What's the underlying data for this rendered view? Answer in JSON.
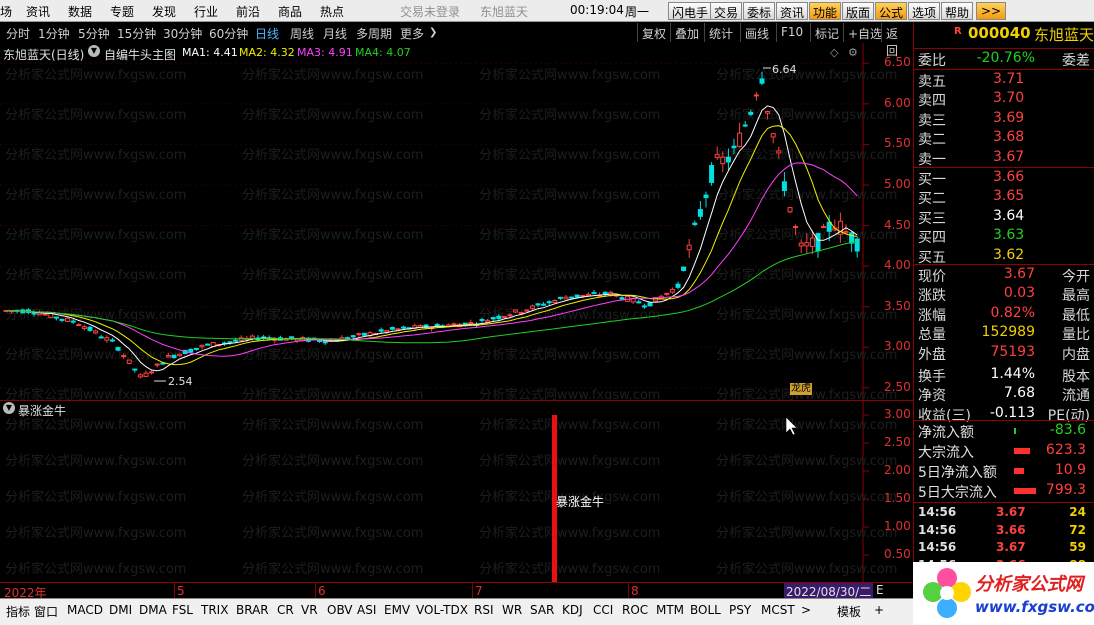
{
  "menubar": {
    "items": [
      "场",
      "资讯",
      "数据",
      "专题",
      "发现",
      "行业",
      "前沿",
      "商品",
      "热点"
    ],
    "status_login": "交易未登录",
    "status_stock": "东旭蓝天",
    "clock": "00:19:04",
    "weekday": "周一",
    "buttons": [
      "闪电手",
      "交易",
      "委标",
      "资讯",
      "功能",
      "版面",
      "公式",
      "选项",
      "帮助",
      ">>"
    ]
  },
  "periodbar": {
    "periods": [
      "分时",
      "1分钟",
      "5分钟",
      "15分钟",
      "30分钟",
      "60分钟",
      "日线",
      "周线",
      "月线",
      "多周期",
      "更多"
    ],
    "selected": "日线",
    "tools": [
      "复权",
      "叠加",
      "统计",
      "画线",
      "F10",
      "标记",
      "+自选",
      "返回"
    ]
  },
  "main_chart": {
    "title": "东旭蓝天(日线)",
    "formula": "自编牛头主图",
    "ma1": "MA1: 4.41",
    "ma2": "MA2: 4.32",
    "ma3": "MA3: 4.91",
    "ma4": "MA4: 4.07",
    "high_label": "6.64",
    "low_label": "2.54",
    "tag": "龙虎",
    "y_ticks": [
      "6.50",
      "6.00",
      "5.50",
      "5.00",
      "4.50",
      "4.00",
      "3.50",
      "3.00",
      "2.50"
    ]
  },
  "sub_chart": {
    "title": "暴涨金牛",
    "signal_label": "暴涨金牛",
    "y_ticks": [
      "3.00",
      "2.50",
      "2.00",
      "1.50",
      "1.00",
      "0.50"
    ]
  },
  "time_axis": {
    "labels": [
      "2022年",
      "5",
      "6",
      "7",
      "8"
    ],
    "current_date": "2022/08/30/二",
    "right_label": "E"
  },
  "watermark": "分析家公式网www.fxgsw.com",
  "bottombar": {
    "items": [
      "指标",
      "窗口",
      "MACD",
      "DMI",
      "DMA",
      "FSL",
      "TRIX",
      "BRAR",
      "CR",
      "VR",
      "OBV",
      "ASI",
      "EMV",
      "VOL-TDX",
      "RSI",
      "WR",
      "SAR",
      "KDJ",
      "CCI",
      "ROC",
      "MTM",
      "BOLL",
      "PSY",
      "MCST",
      ">",
      "模板",
      "+"
    ]
  },
  "quote": {
    "mark": "R",
    "code": "000040",
    "name": "东旭蓝天",
    "weibi_label": "委比",
    "weibi_value": "-20.76%",
    "weicha_label": "委差",
    "asks": [
      {
        "label": "卖五",
        "price": "3.71"
      },
      {
        "label": "卖四",
        "price": "3.70"
      },
      {
        "label": "卖三",
        "price": "3.69"
      },
      {
        "label": "卖二",
        "price": "3.68"
      },
      {
        "label": "卖一",
        "price": "3.67"
      }
    ],
    "bids": [
      {
        "label": "买一",
        "price": "3.66"
      },
      {
        "label": "买二",
        "price": "3.65"
      },
      {
        "label": "买三",
        "price": "3.64"
      },
      {
        "label": "买四",
        "price": "3.63"
      },
      {
        "label": "买五",
        "price": "3.62"
      }
    ],
    "stats": [
      {
        "label": "现价",
        "value": "3.67",
        "right": "今开"
      },
      {
        "label": "涨跌",
        "value": "0.03",
        "right": "最高"
      },
      {
        "label": "涨幅",
        "value": "0.82%",
        "right": "最低"
      },
      {
        "label": "总量",
        "value": "152989",
        "right": "量比"
      },
      {
        "label": "外盘",
        "value": "75193",
        "right": "内盘"
      },
      {
        "label": "换手",
        "value": "1.44%",
        "right": "股本"
      },
      {
        "label": "净资",
        "value": "7.68",
        "right": "流通"
      },
      {
        "label": "收益(三)",
        "value": "-0.113",
        "right": "PE(动)"
      }
    ],
    "flows": [
      {
        "label": "净流入额",
        "value": "-83.6"
      },
      {
        "label": "大宗流入",
        "value": "623.3"
      },
      {
        "label": "5日净流入额",
        "value": "10.9"
      },
      {
        "label": "5日大宗流入",
        "value": "799.3"
      }
    ],
    "ticks": [
      {
        "time": "14:56",
        "price": "3.67",
        "vol": "24"
      },
      {
        "time": "14:56",
        "price": "3.66",
        "vol": "72"
      },
      {
        "time": "14:56",
        "price": "3.67",
        "vol": "59"
      },
      {
        "time": "14:56",
        "price": "3.66",
        "vol": "88"
      }
    ]
  },
  "logo": {
    "title": "分析家公式网",
    "url": "www.fxgsw.com"
  },
  "colors": {
    "up": "#ff4040",
    "down": "#00e0e0",
    "ma1": "#ffffff",
    "ma2": "#f0f000",
    "ma3": "#ff40ff",
    "ma4": "#20d020"
  }
}
